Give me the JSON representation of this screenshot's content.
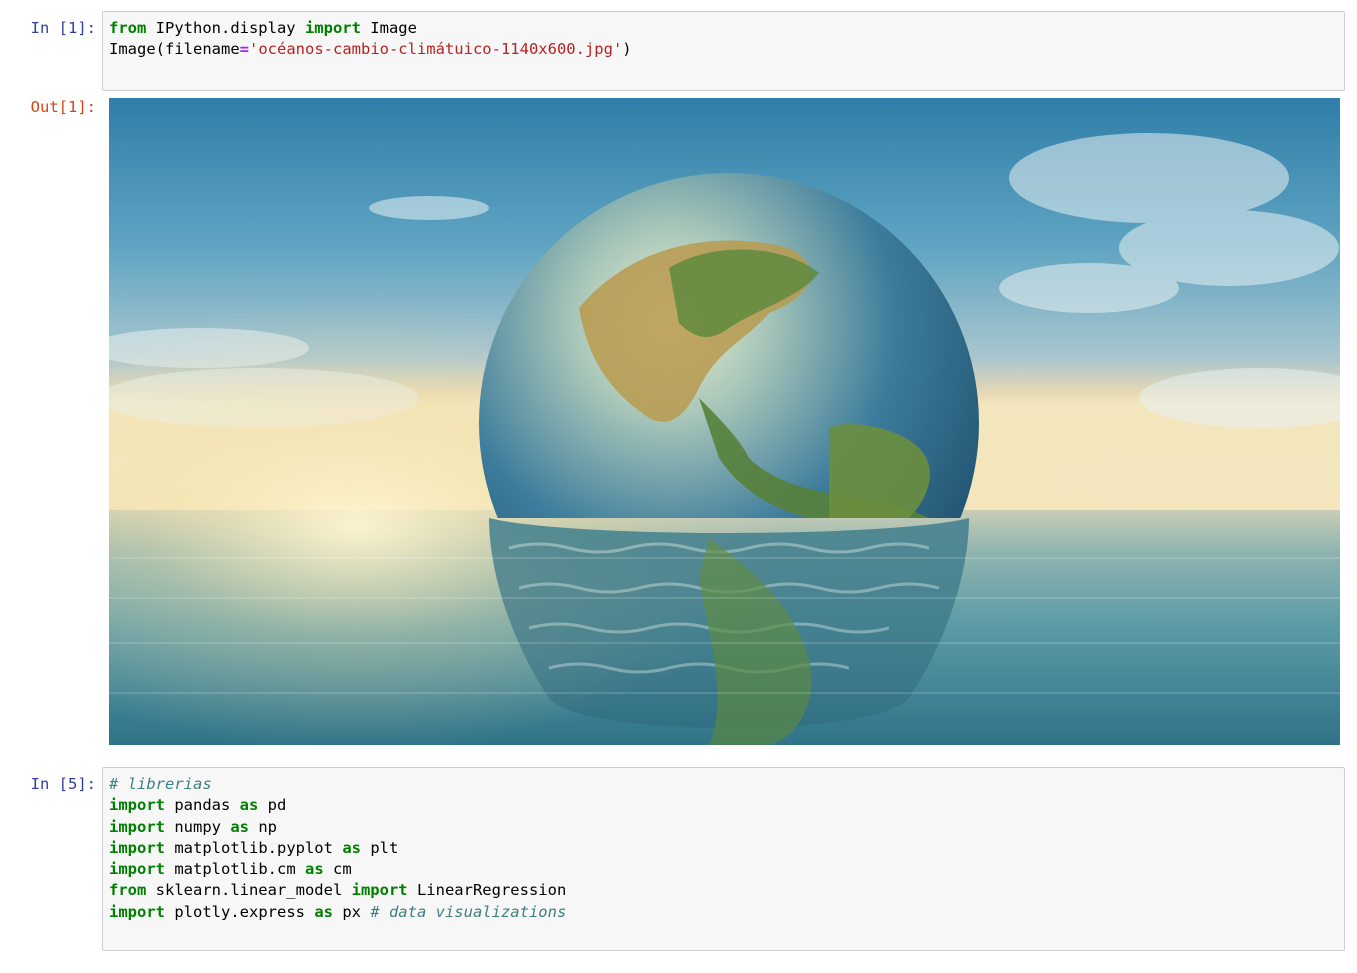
{
  "cells": [
    {
      "prompt": "In [1]:",
      "lines": [
        [
          {
            "t": "from",
            "c": "kw"
          },
          {
            "t": " IPython.display ",
            "c": ""
          },
          {
            "t": "import",
            "c": "kw"
          },
          {
            "t": " Image",
            "c": ""
          }
        ],
        [
          {
            "t": "Image(filename",
            "c": ""
          },
          {
            "t": "=",
            "c": "op"
          },
          {
            "t": "'océanos-cambio-climátuico-1140x600.jpg'",
            "c": "str"
          },
          {
            "t": ")",
            "c": ""
          }
        ]
      ]
    },
    {
      "prompt": "In [5]:",
      "lines": [
        [
          {
            "t": "# librerias",
            "c": "cm"
          }
        ],
        [
          {
            "t": "import",
            "c": "kw"
          },
          {
            "t": " pandas ",
            "c": ""
          },
          {
            "t": "as",
            "c": "kw"
          },
          {
            "t": " pd",
            "c": ""
          }
        ],
        [
          {
            "t": "import",
            "c": "kw"
          },
          {
            "t": " numpy ",
            "c": ""
          },
          {
            "t": "as",
            "c": "kw"
          },
          {
            "t": " np",
            "c": ""
          }
        ],
        [
          {
            "t": "import",
            "c": "kw"
          },
          {
            "t": " matplotlib.pyplot ",
            "c": ""
          },
          {
            "t": "as",
            "c": "kw"
          },
          {
            "t": " plt",
            "c": ""
          }
        ],
        [
          {
            "t": "import",
            "c": "kw"
          },
          {
            "t": " matplotlib.cm ",
            "c": ""
          },
          {
            "t": "as",
            "c": "kw"
          },
          {
            "t": " cm",
            "c": ""
          }
        ],
        [
          {
            "t": "from",
            "c": "kw"
          },
          {
            "t": " sklearn.linear_model ",
            "c": ""
          },
          {
            "t": "import",
            "c": "kw"
          },
          {
            "t": " LinearRegression",
            "c": ""
          }
        ],
        [
          {
            "t": "import",
            "c": "kw"
          },
          {
            "t": " plotly.express ",
            "c": ""
          },
          {
            "t": "as",
            "c": "kw"
          },
          {
            "t": " px ",
            "c": ""
          },
          {
            "t": "# data visualizations",
            "c": "cm"
          }
        ]
      ]
    }
  ],
  "output": {
    "prompt": "Out[1]:",
    "image_subject": "earth-globe-half-submerged-in-ocean"
  },
  "colors": {
    "prompt_in": "#303f9f",
    "prompt_out": "#d84315",
    "keyword": "#008000",
    "operator": "#aa22ff",
    "string": "#ba2121",
    "comment": "#408080",
    "cell_bg": "#f7f7f7",
    "cell_border": "#cfcfcf"
  }
}
